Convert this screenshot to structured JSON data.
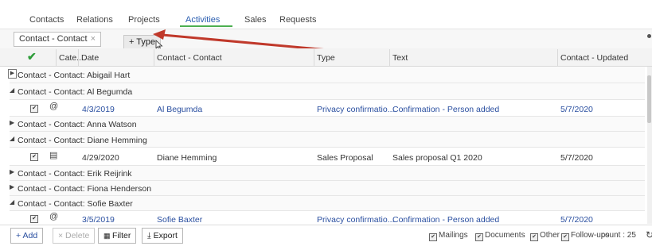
{
  "tabs": [
    "Contacts",
    "Relations",
    "Projects",
    "Activities",
    "Sales",
    "Requests"
  ],
  "active_tab": "Activities",
  "group_chip": {
    "label": "Contact - Contact",
    "close": "×"
  },
  "drag_chip": {
    "label": "+ Type"
  },
  "columns": {
    "check": "✔",
    "category": "Cate...",
    "date": "Date",
    "contact": "Contact - Contact",
    "type": "Type",
    "text": "Text",
    "updated": "Contact - Updated"
  },
  "groups": [
    {
      "label": "Contact - Contact: Abigail Hart",
      "expanded": false
    },
    {
      "label": "Contact - Contact: Al Begumda",
      "expanded": true,
      "row": {
        "check": "✔",
        "cat": "@",
        "date": "4/3/2019",
        "contact": "Al Begumda",
        "type": "Privacy confirmatio...",
        "text": "Confirmation - Person added",
        "updated": "5/7/2020",
        "style": "blue"
      }
    },
    {
      "label": "Contact - Contact: Anna Watson",
      "expanded": false
    },
    {
      "label": "Contact - Contact: Diane Hemming",
      "expanded": true,
      "row": {
        "check": "✔",
        "cat": "▤",
        "date": "4/29/2020",
        "contact": "Diane Hemming",
        "type": "Sales Proposal",
        "text": "Sales proposal Q1 2020",
        "updated": "5/7/2020",
        "style": "dark"
      }
    },
    {
      "label": "Contact - Contact: Erik Reijrink",
      "expanded": false
    },
    {
      "label": "Contact - Contact: Fiona Henderson",
      "expanded": false
    },
    {
      "label": "Contact - Contact: Sofie Baxter",
      "expanded": true,
      "row": {
        "check": "✔",
        "cat": "@",
        "date": "3/5/2019",
        "contact": "Sofie Baxter",
        "type": "Privacy confirmatio...",
        "text": "Confirmation - Person added",
        "updated": "5/7/2020",
        "style": "blue"
      }
    }
  ],
  "footer": {
    "add": "+ Add",
    "delete": "× Delete",
    "filter": "Filter",
    "export": "Export",
    "filters": [
      "Mailings",
      "Documents",
      "Other",
      "Follow-ups"
    ],
    "count": "count : 25"
  },
  "colors": {
    "accent": "#4caf50",
    "link": "#2a4fa0",
    "arrow": "#c0392b"
  }
}
